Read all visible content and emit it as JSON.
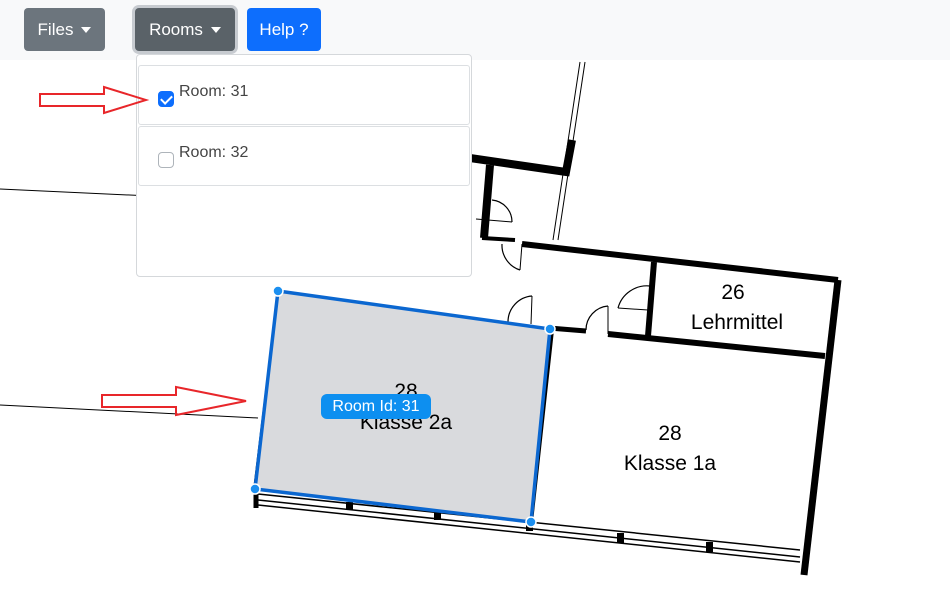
{
  "toolbar": {
    "files_label": "Files",
    "rooms_label": "Rooms",
    "help_label": "Help ?"
  },
  "rooms_menu": {
    "items": [
      {
        "label": "Room: 31",
        "checked": true
      },
      {
        "label": "Room: 32",
        "checked": false
      }
    ]
  },
  "floorplan": {
    "rooms": [
      {
        "number": "26",
        "name": "Lehrmittel"
      },
      {
        "number": "28",
        "name": "Klasse 2a",
        "selected": true
      },
      {
        "number": "28",
        "name": "Klasse 1a"
      }
    ],
    "selection_tag": "Room Id: 31"
  },
  "colors": {
    "primary": "#0d6efd",
    "secondary": "#6c757d",
    "selection_fill": "#d9dadd",
    "selection_outline": "#0b67d0",
    "annotation_arrow": "#e8262a"
  }
}
